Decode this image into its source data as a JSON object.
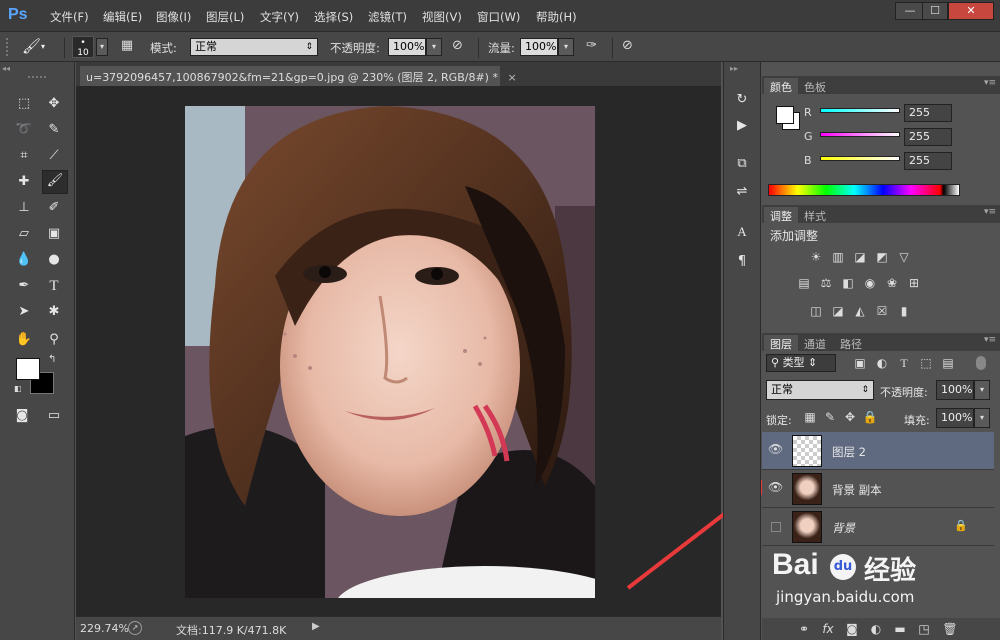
{
  "app": {
    "logo": "Ps"
  },
  "menu": [
    "文件(F)",
    "编辑(E)",
    "图像(I)",
    "图层(L)",
    "文字(Y)",
    "选择(S)",
    "滤镜(T)",
    "视图(V)",
    "窗口(W)",
    "帮助(H)"
  ],
  "window_controls": {
    "minimize": "—",
    "maximize": "☐",
    "close": "✕"
  },
  "options": {
    "brush_size": "10",
    "mode_label": "模式:",
    "mode_value": "正常",
    "opacity_label": "不透明度:",
    "opacity_value": "100%",
    "flow_label": "流量:",
    "flow_value": "100%"
  },
  "document": {
    "tab_title": "u=3792096457,100867902&fm=21&gp=0.jpg @ 230% (图层 2, RGB/8#) *",
    "tab_close": "×",
    "zoom": "229.74%",
    "doc_info": "文档:117.9 K/471.8K"
  },
  "color_panel": {
    "tabs": [
      "颜色",
      "色板"
    ],
    "channels": [
      {
        "label": "R",
        "value": "255"
      },
      {
        "label": "G",
        "value": "255"
      },
      {
        "label": "B",
        "value": "255"
      }
    ]
  },
  "adjust_panel": {
    "tabs": [
      "调整",
      "样式"
    ],
    "title": "添加调整"
  },
  "layers_panel": {
    "tabs": [
      "图层",
      "通道",
      "路径"
    ],
    "filter_kind": "类型",
    "blend_mode": "正常",
    "opacity_label": "不透明度:",
    "opacity_value": "100%",
    "lock_label": "锁定:",
    "fill_label": "填充:",
    "fill_value": "100%",
    "layers": [
      {
        "name": "图层 2",
        "visible": true,
        "selected": true
      },
      {
        "name": "背景 副本",
        "visible": true,
        "selected": false
      },
      {
        "name": "背景",
        "visible": false,
        "selected": false
      }
    ]
  },
  "watermark": {
    "text1": "Bai",
    "text2": "经验",
    "url": "jingyan.baidu.com"
  },
  "colors": {
    "accent": "#e8393b",
    "selected_layer": "#5f6a80"
  }
}
